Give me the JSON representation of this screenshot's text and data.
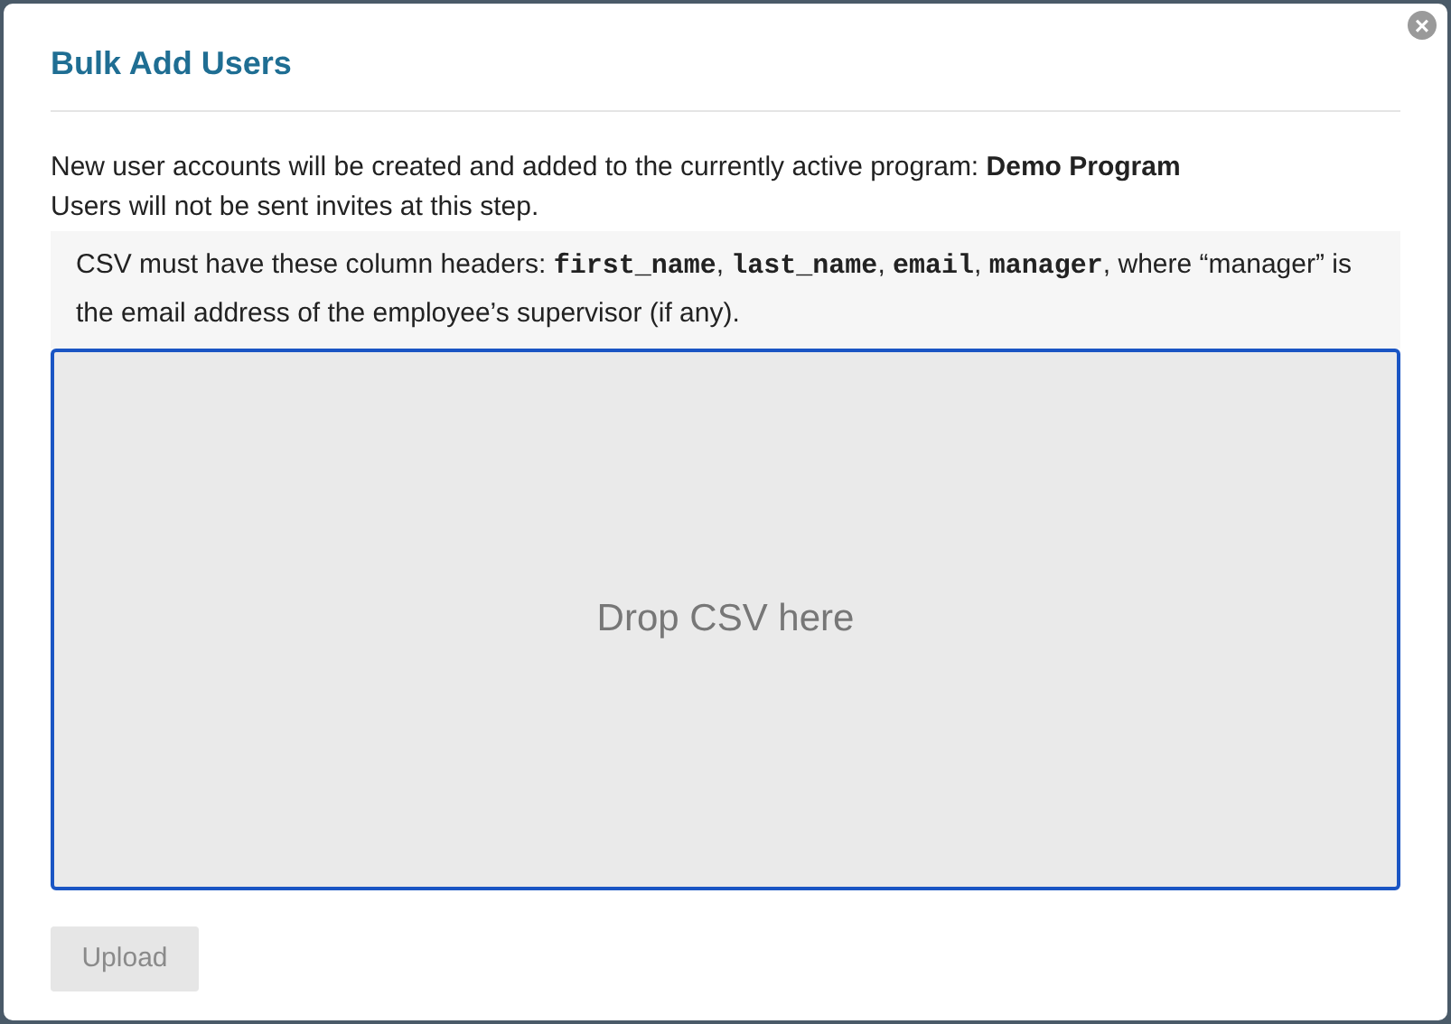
{
  "dialog": {
    "title": "Bulk Add Users",
    "close_icon": "×"
  },
  "intro": "New user accounts will be created and added to the currently active program: **Demo Program**",
  "invite_note": "Users will not be sent invites at this step.",
  "csv_note": [
    {
      "kind": "text",
      "text": "CSV must have these column headers: "
    },
    {
      "kind": "code",
      "text": "first_name"
    },
    {
      "kind": "text",
      "text": ", "
    },
    {
      "kind": "code",
      "text": "last_name"
    },
    {
      "kind": "text",
      "text": ", "
    },
    {
      "kind": "code",
      "text": "email"
    },
    {
      "kind": "text",
      "text": ", "
    },
    {
      "kind": "code",
      "text": "manager"
    },
    {
      "kind": "text",
      "text": ", where “manager” is the email address of the employee’s supervisor (if any)."
    }
  ],
  "dropzone": {
    "label": "Drop CSV here",
    "focused": true
  },
  "upload_button": {
    "label": "Upload",
    "disabled": true
  }
}
